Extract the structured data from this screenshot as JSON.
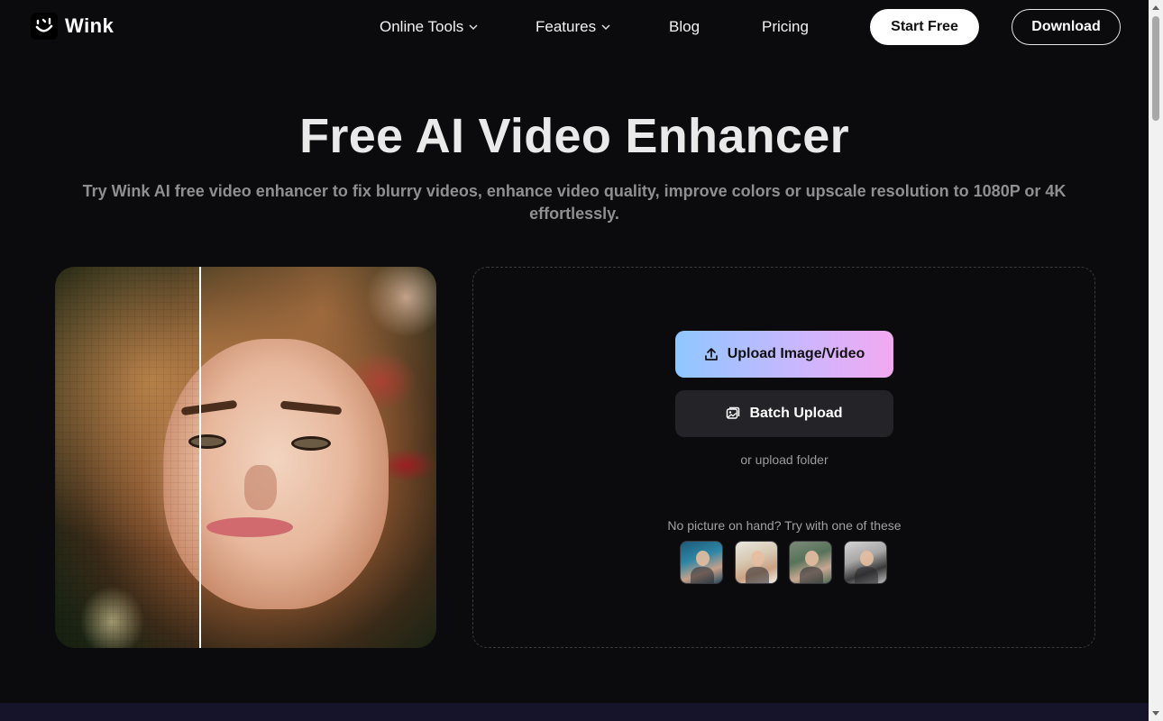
{
  "brand": {
    "name": "Wink",
    "logo_icon": "wink-logo-icon"
  },
  "nav": {
    "items": [
      {
        "label": "Online Tools",
        "has_dropdown": true
      },
      {
        "label": "Features",
        "has_dropdown": true
      },
      {
        "label": "Blog",
        "has_dropdown": false
      },
      {
        "label": "Pricing",
        "has_dropdown": false
      }
    ],
    "start_free": "Start Free",
    "download": "Download"
  },
  "hero": {
    "title": "Free AI Video Enhancer",
    "subtitle": "Try Wink AI free video enhancer to fix blurry videos, enhance video quality, improve colors or upscale resolution to 1080P or 4K effortlessly."
  },
  "comparison": {
    "left_label": "",
    "right_label": ""
  },
  "upload": {
    "primary_button": "Upload Image/Video",
    "primary_icon": "upload-icon",
    "batch_button": "Batch Upload",
    "batch_icon": "images-icon",
    "folder_link": "or upload folder",
    "samples_hint": "No picture on hand? Try with one of these",
    "samples": [
      "sample-1",
      "sample-2",
      "sample-3",
      "sample-4"
    ]
  },
  "colors": {
    "background": "#0b0b0d",
    "upload_gradient_start": "#8fc7ff",
    "upload_gradient_end": "#f3a9f1",
    "batch_bg": "#242428"
  }
}
